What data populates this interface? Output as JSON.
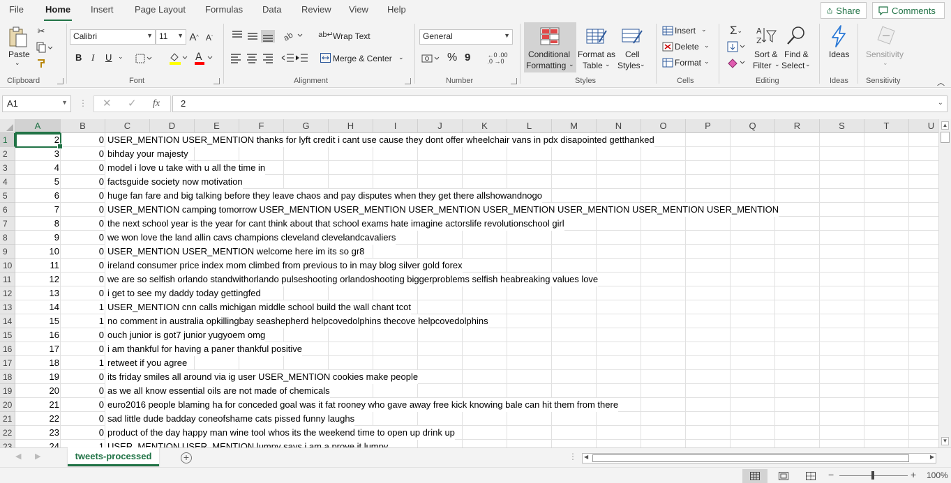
{
  "menu": {
    "tabs": [
      "File",
      "Home",
      "Insert",
      "Page Layout",
      "Formulas",
      "Data",
      "Review",
      "View",
      "Help"
    ],
    "active": "Home",
    "share_label": "Share",
    "comments_label": "Comments"
  },
  "ribbon": {
    "clipboard": {
      "paste": "Paste",
      "label": "Clipboard"
    },
    "font": {
      "name": "Calibri",
      "size": "11",
      "bold": "B",
      "italic": "I",
      "underline": "U",
      "label": "Font"
    },
    "alignment": {
      "wrap_text": "Wrap Text",
      "merge_center": "Merge & Center",
      "label": "Alignment"
    },
    "number": {
      "format": "General",
      "percent": "%",
      "comma": "9",
      "label": "Number"
    },
    "styles": {
      "conditional_line1": "Conditional",
      "conditional_line2": "Formatting",
      "format_table_line1": "Format as",
      "format_table_line2": "Table",
      "cell_styles_line1": "Cell",
      "cell_styles_line2": "Styles",
      "label": "Styles"
    },
    "cells": {
      "insert": "Insert",
      "delete": "Delete",
      "format": "Format",
      "label": "Cells"
    },
    "editing": {
      "sort_line1": "Sort &",
      "sort_line2": "Filter",
      "find_line1": "Find &",
      "find_line2": "Select",
      "label": "Editing"
    },
    "ideas": {
      "button": "Ideas",
      "label": "Ideas"
    },
    "sensitivity": {
      "button": "Sensitivity",
      "label": "Sensitivity"
    }
  },
  "formula_bar": {
    "name_box": "A1",
    "fx": "fx",
    "value": "2"
  },
  "columns": [
    "A",
    "B",
    "C",
    "D",
    "E",
    "F",
    "G",
    "H",
    "I",
    "J",
    "K",
    "L",
    "M",
    "N",
    "O",
    "P",
    "Q",
    "R",
    "S",
    "T",
    "U"
  ],
  "rows": [
    {
      "n": "1",
      "a": "2",
      "b": "0",
      "c": "USER_MENTION USER_MENTION thanks for lyft credit i cant use cause they dont offer wheelchair vans in pdx disapointed getthanked"
    },
    {
      "n": "2",
      "a": "3",
      "b": "0",
      "c": "bihday your majesty"
    },
    {
      "n": "3",
      "a": "4",
      "b": "0",
      "c": "model i love u take with u all the time in"
    },
    {
      "n": "4",
      "a": "5",
      "b": "0",
      "c": "factsguide society now motivation"
    },
    {
      "n": "5",
      "a": "6",
      "b": "0",
      "c": "huge fan fare and big talking before they leave chaos and pay disputes when they get there allshowandnogo"
    },
    {
      "n": "6",
      "a": "7",
      "b": "0",
      "c": "USER_MENTION camping tomorrow USER_MENTION USER_MENTION USER_MENTION USER_MENTION USER_MENTION USER_MENTION USER_MENTION"
    },
    {
      "n": "7",
      "a": "8",
      "b": "0",
      "c": "the next school year is the year for cant think about that school exams hate imagine actorslife revolutionschool girl"
    },
    {
      "n": "8",
      "a": "9",
      "b": "0",
      "c": "we won love the land allin cavs champions cleveland clevelandcavaliers"
    },
    {
      "n": "9",
      "a": "10",
      "b": "0",
      "c": "USER_MENTION USER_MENTION welcome here im its so gr8"
    },
    {
      "n": "10",
      "a": "11",
      "b": "0",
      "c": "ireland consumer price index mom climbed from previous to in may blog silver gold forex"
    },
    {
      "n": "11",
      "a": "12",
      "b": "0",
      "c": "we are so selfish orlando standwithorlando pulseshooting orlandoshooting biggerproblems selfish heabreaking values love"
    },
    {
      "n": "12",
      "a": "13",
      "b": "0",
      "c": "i get to see my daddy today gettingfed"
    },
    {
      "n": "13",
      "a": "14",
      "b": "1",
      "c": "USER_MENTION cnn calls michigan middle school build the wall chant tcot"
    },
    {
      "n": "14",
      "a": "15",
      "b": "1",
      "c": "no comment in australia opkillingbay seashepherd helpcovedolphins thecove helpcovedolphins"
    },
    {
      "n": "15",
      "a": "16",
      "b": "0",
      "c": "ouch junior is got7 junior yugyoem omg"
    },
    {
      "n": "16",
      "a": "17",
      "b": "0",
      "c": "i am thankful for having a paner thankful positive"
    },
    {
      "n": "17",
      "a": "18",
      "b": "1",
      "c": "retweet if you agree"
    },
    {
      "n": "18",
      "a": "19",
      "b": "0",
      "c": "its friday smiles all around via ig user USER_MENTION cookies make people"
    },
    {
      "n": "19",
      "a": "20",
      "b": "0",
      "c": "as we all know essential oils are not made of chemicals"
    },
    {
      "n": "20",
      "a": "21",
      "b": "0",
      "c": "euro2016 people blaming ha for conceded goal was it fat rooney who gave away free kick knowing bale can hit them from there"
    },
    {
      "n": "21",
      "a": "22",
      "b": "0",
      "c": "sad little dude badday coneofshame cats pissed funny laughs"
    },
    {
      "n": "22",
      "a": "23",
      "b": "0",
      "c": "product of the day happy man wine tool whos its the weekend time to open up drink up"
    },
    {
      "n": "23",
      "a": "24",
      "b": "1",
      "c": "USER_MENTION USER_MENTION lumpy says i am a prove it lumpy"
    }
  ],
  "sheet": {
    "tab": "tweets-processed"
  },
  "status": {
    "zoom": "100%"
  }
}
